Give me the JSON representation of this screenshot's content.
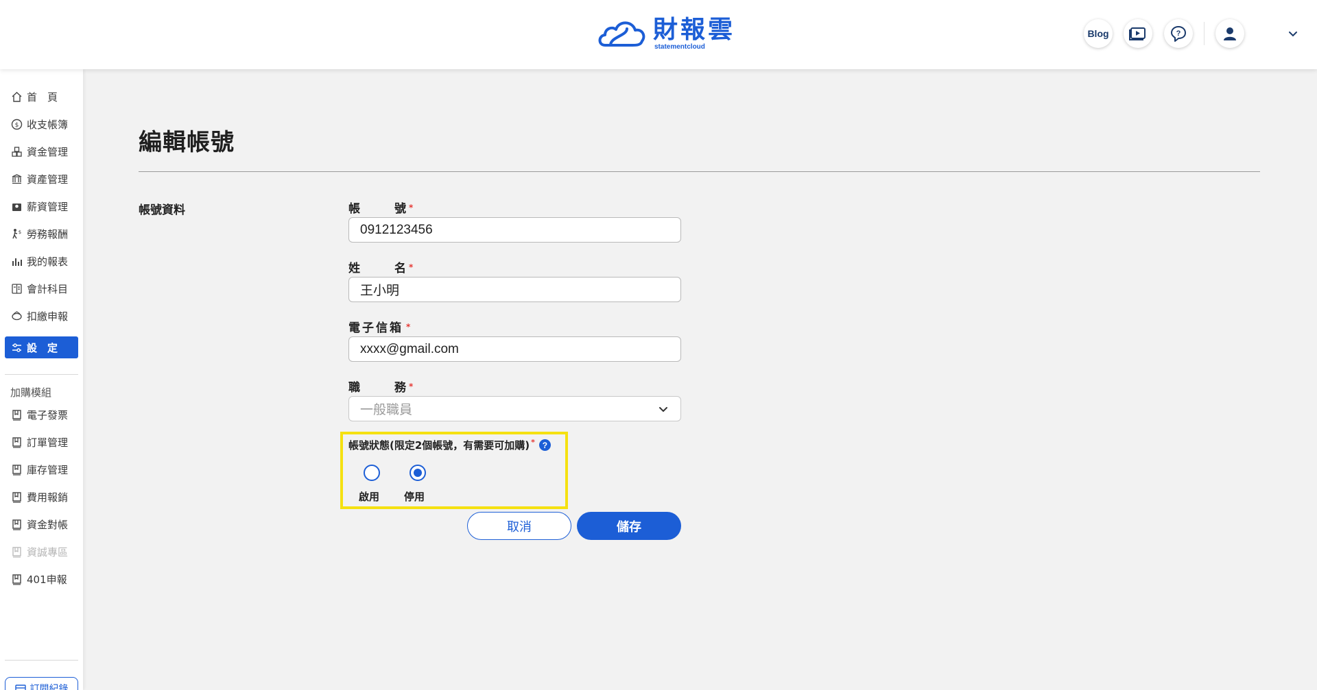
{
  "header": {
    "logo_name": "財報雲",
    "logo_sub": "statementcloud",
    "blog_label": "Blog",
    "icons": [
      "video-guide-icon",
      "help-chat-icon",
      "user-avatar-icon",
      "chevron-down-icon"
    ],
    "brand_color": "#1c5ed6"
  },
  "sidebar": {
    "items": [
      {
        "label": "首　頁",
        "icon": "home-icon"
      },
      {
        "label": "收支帳簿",
        "icon": "coin-icon"
      },
      {
        "label": "資金管理",
        "icon": "fund-icon"
      },
      {
        "label": "資產管理",
        "icon": "asset-icon"
      },
      {
        "label": "薪資管理",
        "icon": "salary-icon"
      },
      {
        "label": "勞務報酬",
        "icon": "labor-icon"
      },
      {
        "label": "我的報表",
        "icon": "report-chart-icon"
      },
      {
        "label": "會計科目",
        "icon": "ledger-icon"
      },
      {
        "label": "扣繳申報",
        "icon": "tax-icon"
      },
      {
        "label": "設　定",
        "icon": "settings-sliders-icon",
        "active": true
      }
    ],
    "addon_heading": "加購模組",
    "addons": [
      {
        "label": "電子發票",
        "icon": "module-icon"
      },
      {
        "label": "訂單管理",
        "icon": "module-icon"
      },
      {
        "label": "庫存管理",
        "icon": "module-icon"
      },
      {
        "label": "費用報銷",
        "icon": "module-icon"
      },
      {
        "label": "資金對帳",
        "icon": "module-icon"
      },
      {
        "label": "資誠專區",
        "icon": "module-icon",
        "disabled": true
      },
      {
        "label": "401申報",
        "icon": "module-icon"
      }
    ],
    "subscription_label": "訂閱紀錄"
  },
  "main": {
    "page_title": "編輯帳號",
    "section_label": "帳號資料",
    "fields": {
      "account": {
        "label_a": "帳",
        "label_b": "號",
        "value": "0912123456"
      },
      "name": {
        "label_a": "姓",
        "label_b": "名",
        "value": "王小明"
      },
      "email": {
        "label": "電子信箱",
        "value": "xxxx@gmail.com"
      },
      "role": {
        "label_a": "職",
        "label_b": "務",
        "selected": "一般職員"
      }
    },
    "required_mark": "*",
    "status": {
      "label": "帳號狀態(限定2個帳號，有需要可加購)",
      "options": [
        {
          "label": "啟用",
          "checked": false
        },
        {
          "label": "停用",
          "checked": true
        }
      ],
      "highlight_color": "#f5e111"
    },
    "buttons": {
      "cancel": "取消",
      "save": "儲存"
    }
  }
}
